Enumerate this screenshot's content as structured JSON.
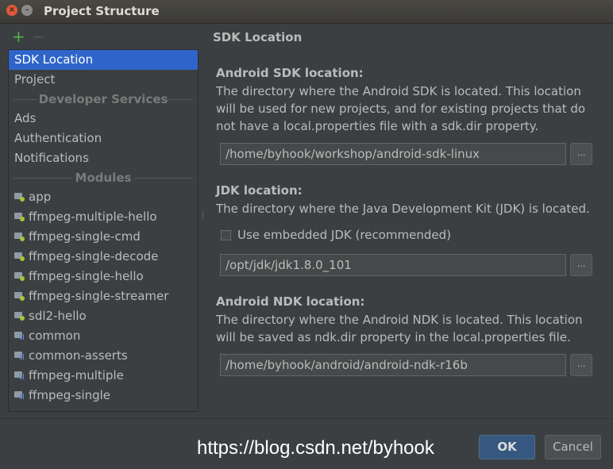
{
  "window": {
    "title": "Project Structure",
    "close_glyph": "×",
    "min_glyph": "–"
  },
  "toolbar": {
    "add_glyph": "+",
    "remove_glyph": "−"
  },
  "sidebar": {
    "top_items": [
      {
        "label": "SDK Location",
        "selected": true
      },
      {
        "label": "Project",
        "selected": false
      }
    ],
    "developer_services": {
      "header": "Developer Services",
      "items": [
        "Ads",
        "Authentication",
        "Notifications"
      ]
    },
    "modules": {
      "header": "Modules",
      "items": [
        {
          "label": "app",
          "icon": "android-module-icon"
        },
        {
          "label": "ffmpeg-multiple-hello",
          "icon": "android-module-icon"
        },
        {
          "label": "ffmpeg-single-cmd",
          "icon": "android-module-icon"
        },
        {
          "label": "ffmpeg-single-decode",
          "icon": "android-module-icon"
        },
        {
          "label": "ffmpeg-single-hello",
          "icon": "android-module-icon"
        },
        {
          "label": "ffmpeg-single-streamer",
          "icon": "android-module-icon"
        },
        {
          "label": "sdl2-hello",
          "icon": "android-module-icon"
        },
        {
          "label": "common",
          "icon": "library-module-icon"
        },
        {
          "label": "common-asserts",
          "icon": "library-module-icon"
        },
        {
          "label": "ffmpeg-multiple",
          "icon": "library-module-icon"
        },
        {
          "label": "ffmpeg-single",
          "icon": "library-module-icon"
        }
      ]
    }
  },
  "panel": {
    "title": "SDK Location",
    "sdk": {
      "heading": "Android SDK location:",
      "description": "The directory where the Android SDK is located. This location will be used for new projects, and for existing projects that do not have a local.properties file with a sdk.dir property.",
      "value": "/home/byhook/workshop/android-sdk-linux",
      "browse": "..."
    },
    "jdk": {
      "heading": "JDK location:",
      "description": "The directory where the Java Development Kit (JDK) is located.",
      "checkbox_label": "Use embedded JDK (recommended)",
      "checkbox_checked": false,
      "value": "/opt/jdk/jdk1.8.0_101",
      "browse": "..."
    },
    "ndk": {
      "heading": "Android NDK location:",
      "description": "The directory where the Android NDK is located. This location will be saved as ndk.dir property in the local.properties file.",
      "value": "/home/byhook/android/android-ndk-r16b",
      "browse": "..."
    }
  },
  "footer": {
    "watermark": "https://blog.csdn.net/byhook",
    "ok_label": "OK",
    "cancel_label": "Cancel"
  },
  "colors": {
    "background": "#3c3f41",
    "selection": "#2f65ca",
    "ok_button": "#365880",
    "android_dot": "#a4c639",
    "add_icon": "#4eb04e"
  }
}
